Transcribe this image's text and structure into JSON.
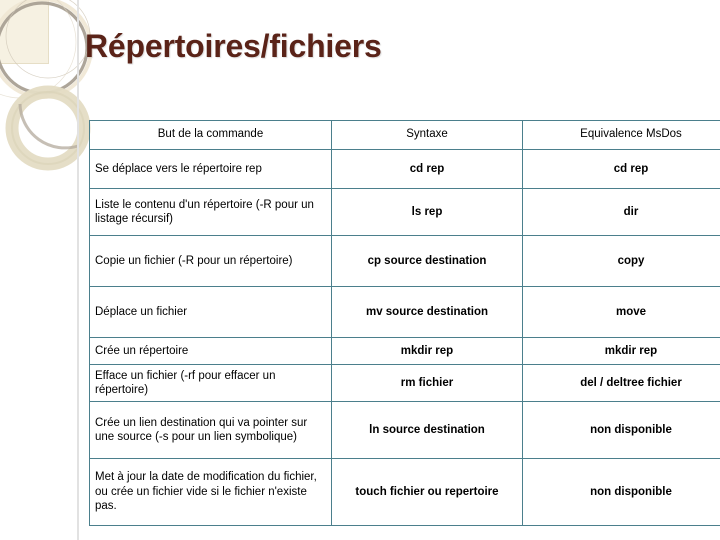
{
  "slide": {
    "title": "Répertoires/fichiers",
    "title_color": "#5a2318",
    "table_border_color": "#4b7f8c",
    "deco_square_color": "#f6f1e2"
  },
  "table": {
    "headers": [
      "But de la commande",
      "Syntaxe",
      "Equivalence MsDos"
    ],
    "rows": [
      {
        "goal": "Se déplace vers le répertoire rep",
        "syntax": "cd rep",
        "msdos": "cd rep"
      },
      {
        "goal": "Liste le contenu d'un répertoire (-R pour un listage récursif)",
        "syntax": "ls rep",
        "msdos": "dir"
      },
      {
        "goal": "Copie un fichier (-R pour un répertoire)",
        "syntax": "cp source destination",
        "msdos": "copy"
      },
      {
        "goal": "Déplace un fichier",
        "syntax": "mv source destination",
        "msdos": "move"
      },
      {
        "goal": "Crée un répertoire",
        "syntax": "mkdir rep",
        "msdos": "mkdir rep"
      },
      {
        "goal": "Efface un fichier (-rf pour effacer un répertoire)",
        "syntax": "rm fichier",
        "msdos": "del / deltree fichier"
      },
      {
        "goal": "Crée un lien destination qui va pointer sur une source (-s pour un lien symbolique)",
        "syntax": "ln source destination",
        "msdos": "non disponible"
      },
      {
        "goal": "Met à jour la date de modification du fichier, ou crée un fichier vide si le fichier n'existe pas.",
        "syntax": "touch fichier ou repertoire",
        "msdos": "non disponible"
      }
    ]
  }
}
